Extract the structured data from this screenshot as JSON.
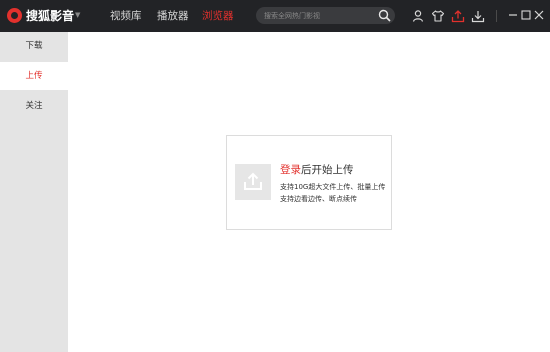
{
  "app": {
    "name": "搜狐影音",
    "brand_color": "#e2312d",
    "titlebar_bg": "#222326"
  },
  "nav": {
    "tabs": [
      {
        "label": "视频库",
        "active": false
      },
      {
        "label": "播放器",
        "active": false
      },
      {
        "label": "浏览器",
        "active": true
      }
    ]
  },
  "search": {
    "placeholder": "搜索全网热门影视",
    "value": "",
    "icon": "search-icon"
  },
  "toolbar": {
    "icons": [
      "user-icon",
      "skin-icon",
      "upload-icon",
      "download-icon",
      "minimize-icon",
      "maximize-icon",
      "close-icon"
    ]
  },
  "sidebar": {
    "items": [
      {
        "label": "下载",
        "active": false
      },
      {
        "label": "上传",
        "active": true
      },
      {
        "label": "关注",
        "active": false
      }
    ]
  },
  "upload_card": {
    "icon": "upload-icon",
    "login_link": "登录",
    "title_suffix": "后开始上传",
    "line1": "支持10G超大文件上传、批量上传",
    "line2": "支持边看边传、断点续传"
  }
}
